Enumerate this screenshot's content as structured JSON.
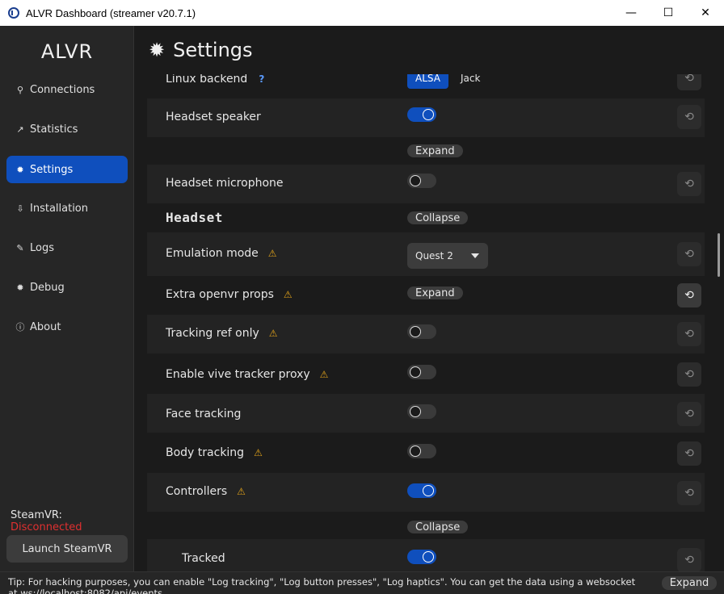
{
  "window": {
    "title": "ALVR Dashboard (streamer v20.7.1)",
    "controls": {
      "minimize": "—",
      "maximize": "☐",
      "close": "✕"
    }
  },
  "sidebar": {
    "brand": "ALVR",
    "items": [
      {
        "label": "Connections",
        "icon": "connections-icon",
        "glyph": "⚲",
        "active": false
      },
      {
        "label": "Statistics",
        "icon": "chart-icon",
        "glyph": "↗",
        "active": false
      },
      {
        "label": "Settings",
        "icon": "gear-icon",
        "glyph": "✹",
        "active": true
      },
      {
        "label": "Installation",
        "icon": "installation-icon",
        "glyph": "⇩",
        "active": false
      },
      {
        "label": "Logs",
        "icon": "logs-icon",
        "glyph": "✎",
        "active": false
      },
      {
        "label": "Debug",
        "icon": "debug-icon",
        "glyph": "✹",
        "active": false
      },
      {
        "label": "About",
        "icon": "info-icon",
        "glyph": "ⓘ",
        "active": false
      }
    ],
    "steamvr_label": "SteamVR:",
    "steamvr_status": "Disconnected",
    "launch_label": "Launch SteamVR"
  },
  "header": {
    "title": "Settings",
    "icon": "gear-icon",
    "glyph": "✹"
  },
  "settings": {
    "linux_backend": {
      "label": "Linux backend",
      "help": "?",
      "options": [
        "ALSA",
        "Jack"
      ],
      "selected": "ALSA"
    },
    "headset_speaker": {
      "label": "Headset speaker",
      "enabled": true
    },
    "speaker_expand": "Expand",
    "headset_microphone": {
      "label": "Headset microphone",
      "enabled": false
    },
    "headset_section": {
      "label": "Headset",
      "collapse": "Collapse"
    },
    "emulation_mode": {
      "label": "Emulation mode",
      "value": "Quest 2"
    },
    "extra_openvr_props": {
      "label": "Extra openvr props",
      "expand": "Expand"
    },
    "tracking_ref_only": {
      "label": "Tracking ref only",
      "enabled": false
    },
    "vive_tracker_proxy": {
      "label": "Enable vive tracker proxy",
      "enabled": false
    },
    "face_tracking": {
      "label": "Face tracking",
      "enabled": false
    },
    "body_tracking": {
      "label": "Body tracking",
      "enabled": false
    },
    "controllers": {
      "label": "Controllers",
      "enabled": true,
      "collapse": "Collapse"
    },
    "tracked": {
      "label": "Tracked",
      "enabled": true
    }
  },
  "icons": {
    "warning": "⚠",
    "reset": "⟲"
  },
  "colors": {
    "accent": "#0f4fbd",
    "warning": "#e0a21a",
    "disconnected": "#e03030"
  },
  "tip": {
    "text": "Tip: For hacking purposes, you can enable \"Log tracking\", \"Log button presses\", \"Log haptics\". You can get the data using a websocket at ws://localhost:8082/api/events",
    "expand": "Expand"
  }
}
